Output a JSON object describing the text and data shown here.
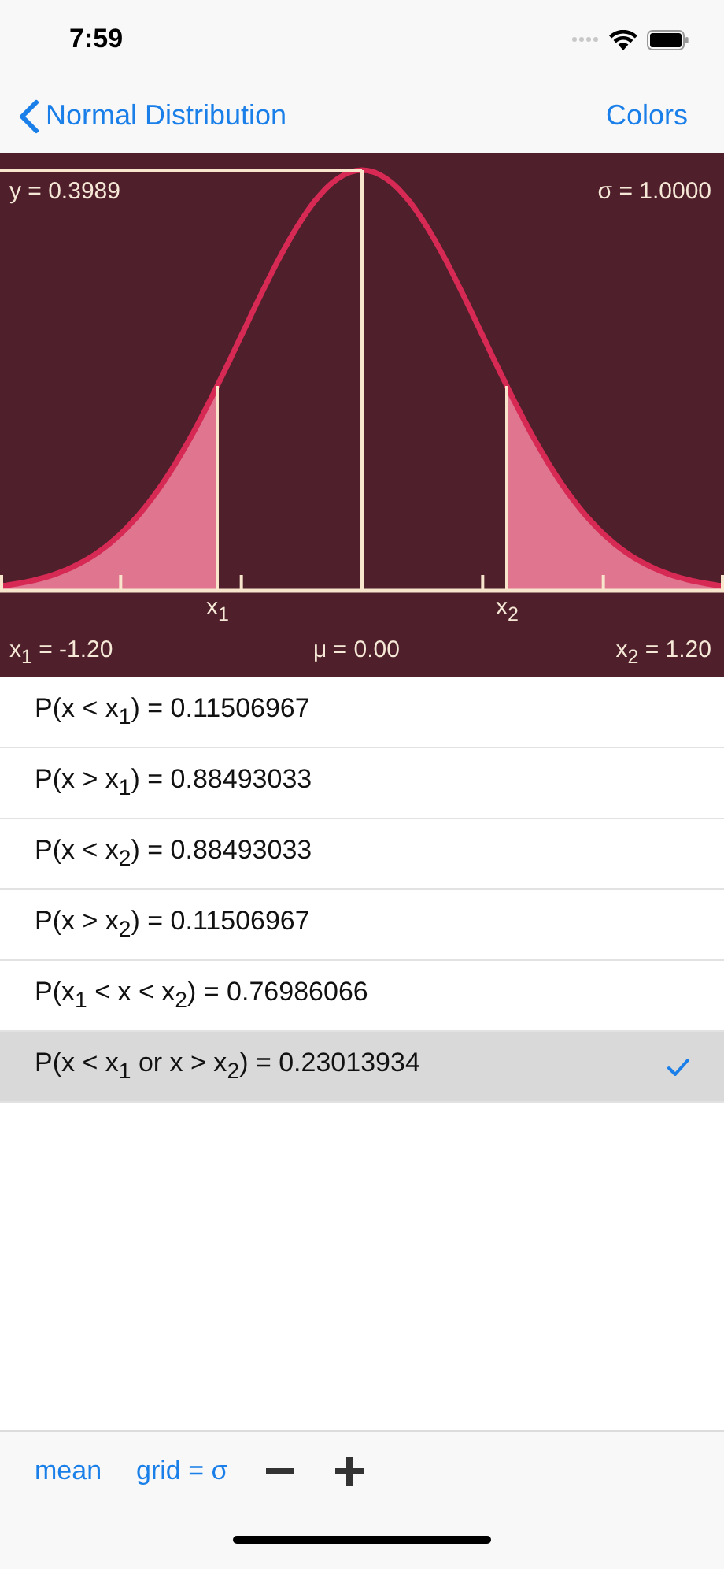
{
  "status_bar": {
    "time": "7:59"
  },
  "nav": {
    "back": "Normal Distribution",
    "action": "Colors"
  },
  "plot": {
    "peak_label": "y = 0.3989",
    "sigma_label": "σ = 1.0000",
    "x1_marker": "x$_{1}$",
    "x2_marker": "x$_{2}$",
    "x1_label": "x$_{1}$ = -1.20",
    "mean_label": "μ = 0.00",
    "x2_label": "x$_{2}$ = 1.20"
  },
  "results": [
    {
      "text": "P(x < x$_{1}$) = 0.11506967",
      "selected": false
    },
    {
      "text": "P(x > x$_{1}$) = 0.88493033",
      "selected": false
    },
    {
      "text": "P(x < x$_{2}$) = 0.88493033",
      "selected": false
    },
    {
      "text": "P(x > x$_{2}$) = 0.11506967",
      "selected": false
    },
    {
      "text": "P(x$_{1}$ < x < x$_{2}$) = 0.76986066",
      "selected": false
    },
    {
      "text": "P(x < x$_{1}$ or x > x$_{2}$) = 0.23013934",
      "selected": true
    }
  ],
  "toolbar": {
    "mean": "mean",
    "grid": "grid = σ"
  }
}
